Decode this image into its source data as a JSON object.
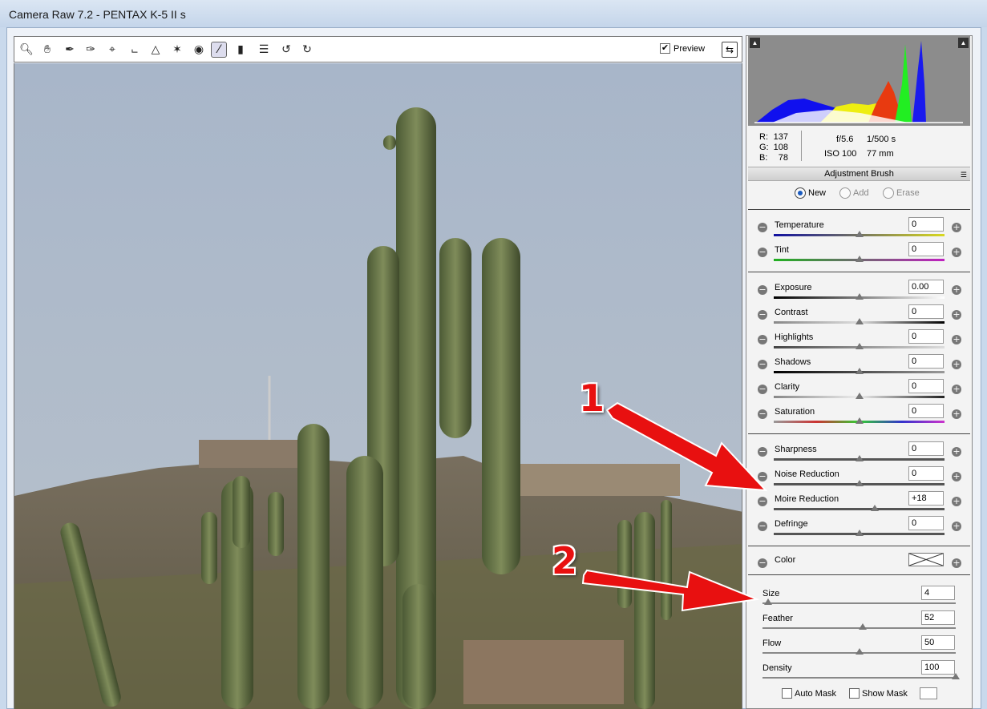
{
  "window": {
    "title": "Camera Raw 7.2  -  PENTAX K-5 II s"
  },
  "toolbar": {
    "tools": [
      "zoom-icon",
      "hand-icon",
      "white-balance-icon",
      "color-sampler-icon",
      "targeted-adjustment-icon",
      "crop-icon",
      "straighten-icon",
      "spot-removal-icon",
      "red-eye-icon",
      "adjustment-brush-icon",
      "graduated-filter-icon",
      "preferences-icon",
      "rotate-ccw-icon",
      "rotate-cw-icon"
    ],
    "preview_label": "Preview",
    "preview_checked": true
  },
  "readout": {
    "r_label": "R:",
    "r": "137",
    "g_label": "G:",
    "g": "108",
    "b_label": "B:",
    "b": "78",
    "aperture": "f/5.6",
    "shutter": "1/500 s",
    "iso": "ISO 100",
    "focal": "77 mm"
  },
  "panel": {
    "title": "Adjustment Brush",
    "modes": [
      {
        "label": "New",
        "on": true
      },
      {
        "label": "Add",
        "on": false
      },
      {
        "label": "Erase",
        "on": false
      }
    ]
  },
  "sliders": {
    "temperature": {
      "label": "Temperature",
      "value": "0",
      "pos": 0.5
    },
    "tint": {
      "label": "Tint",
      "value": "0",
      "pos": 0.5
    },
    "exposure": {
      "label": "Exposure",
      "value": "0.00",
      "pos": 0.5
    },
    "contrast": {
      "label": "Contrast",
      "value": "0",
      "pos": 0.5
    },
    "highlights": {
      "label": "Highlights",
      "value": "0",
      "pos": 0.5
    },
    "shadows": {
      "label": "Shadows",
      "value": "0",
      "pos": 0.5
    },
    "clarity": {
      "label": "Clarity",
      "value": "0",
      "pos": 0.5
    },
    "saturation": {
      "label": "Saturation",
      "value": "0",
      "pos": 0.5
    },
    "sharpness": {
      "label": "Sharpness",
      "value": "0",
      "pos": 0.5
    },
    "noise_reduction": {
      "label": "Noise Reduction",
      "value": "0",
      "pos": 0.5
    },
    "moire_reduction": {
      "label": "Moire Reduction",
      "value": "+18",
      "pos": 0.59
    },
    "defringe": {
      "label": "Defringe",
      "value": "0",
      "pos": 0.5
    }
  },
  "color": {
    "label": "Color"
  },
  "brush": {
    "size": {
      "label": "Size",
      "value": "4",
      "pos": 0.03
    },
    "feather": {
      "label": "Feather",
      "value": "52",
      "pos": 0.52
    },
    "flow": {
      "label": "Flow",
      "value": "50",
      "pos": 0.5
    },
    "density": {
      "label": "Density",
      "value": "100",
      "pos": 1.0
    }
  },
  "masks": {
    "auto_mask": "Auto Mask",
    "show_mask": "Show Mask"
  },
  "annotations": {
    "one": "1",
    "two": "2"
  },
  "colors": {
    "annotation": "#e81010",
    "radio_on": "#1a5bbf"
  }
}
